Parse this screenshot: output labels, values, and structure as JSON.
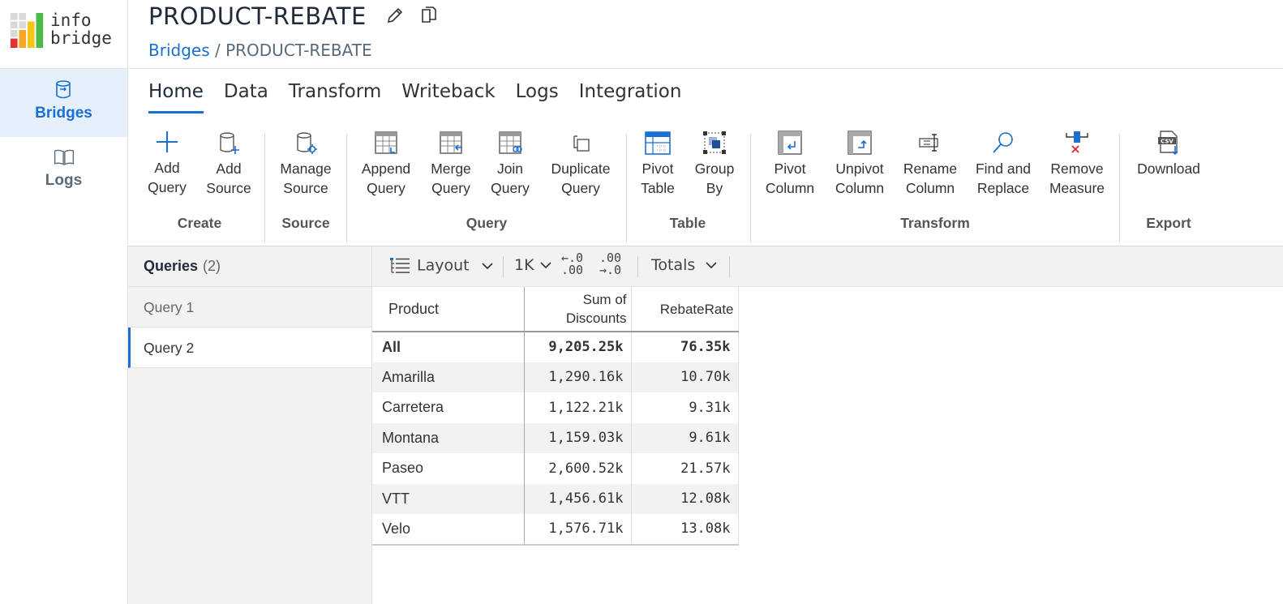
{
  "app": {
    "logo_text_line1": "info",
    "logo_text_line2": "bridge",
    "title": "PRODUCT-REBATE",
    "breadcrumb_link": "Bridges",
    "breadcrumb_sep": " / ",
    "breadcrumb_current": "PRODUCT-REBATE",
    "accent_color": "#1a6fd1"
  },
  "sidebar": {
    "items": [
      {
        "label": "Bridges",
        "icon": "database-icon",
        "active": true
      },
      {
        "label": "Logs",
        "icon": "book-icon",
        "active": false
      }
    ]
  },
  "tabs": [
    "Home",
    "Data",
    "Transform",
    "Writeback",
    "Logs",
    "Integration"
  ],
  "ribbon": {
    "buttons": {
      "add_query": [
        "Add",
        "Query"
      ],
      "add_source": [
        "Add",
        "Source"
      ],
      "manage_source": [
        "Manage",
        "Source"
      ],
      "append_query": [
        "Append",
        "Query"
      ],
      "merge_query": [
        "Merge",
        "Query"
      ],
      "join_query": [
        "Join",
        "Query"
      ],
      "duplicate_query": [
        "Duplicate",
        "Query"
      ],
      "pivot_table": [
        "Pivot",
        "Table"
      ],
      "group_by": [
        "Group",
        "By"
      ],
      "pivot_column": [
        "Pivot",
        "Column"
      ],
      "unpivot_column": [
        "Unpivot",
        "Column"
      ],
      "rename_column": [
        "Rename",
        "Column"
      ],
      "find_replace": [
        "Find and",
        "Replace"
      ],
      "remove_measure": [
        "Remove",
        "Measure"
      ],
      "download": [
        "Download",
        ""
      ]
    },
    "groups": {
      "create": "Create",
      "source": "Source",
      "query": "Query",
      "table": "Table",
      "transform": "Transform",
      "export": "Export"
    }
  },
  "queries": {
    "title": "Queries",
    "count": "(2)",
    "items": [
      "Query 1",
      "Query 2"
    ]
  },
  "table_toolbar": {
    "layout": "Layout",
    "scale": "1K",
    "dec_less_top": "←.0",
    "dec_less_bottom": ".00",
    "dec_more_top": ".00",
    "dec_more_bottom": "→.0",
    "totals": "Totals"
  },
  "grid": {
    "headers": {
      "product": "Product",
      "discounts_l1": "Sum of",
      "discounts_l2": "Discounts",
      "rebate": "RebateRate"
    },
    "rows": [
      {
        "product": "All",
        "discounts": "9,205.25k",
        "rebate": "76.35k"
      },
      {
        "product": "Amarilla",
        "discounts": "1,290.16k",
        "rebate": "10.70k"
      },
      {
        "product": "Carretera",
        "discounts": "1,122.21k",
        "rebate": "9.31k"
      },
      {
        "product": "Montana",
        "discounts": "1,159.03k",
        "rebate": "9.61k"
      },
      {
        "product": "Paseo",
        "discounts": "2,600.52k",
        "rebate": "21.57k"
      },
      {
        "product": "VTT",
        "discounts": "1,456.61k",
        "rebate": "12.08k"
      },
      {
        "product": "Velo",
        "discounts": "1,576.71k",
        "rebate": "13.08k"
      }
    ]
  }
}
